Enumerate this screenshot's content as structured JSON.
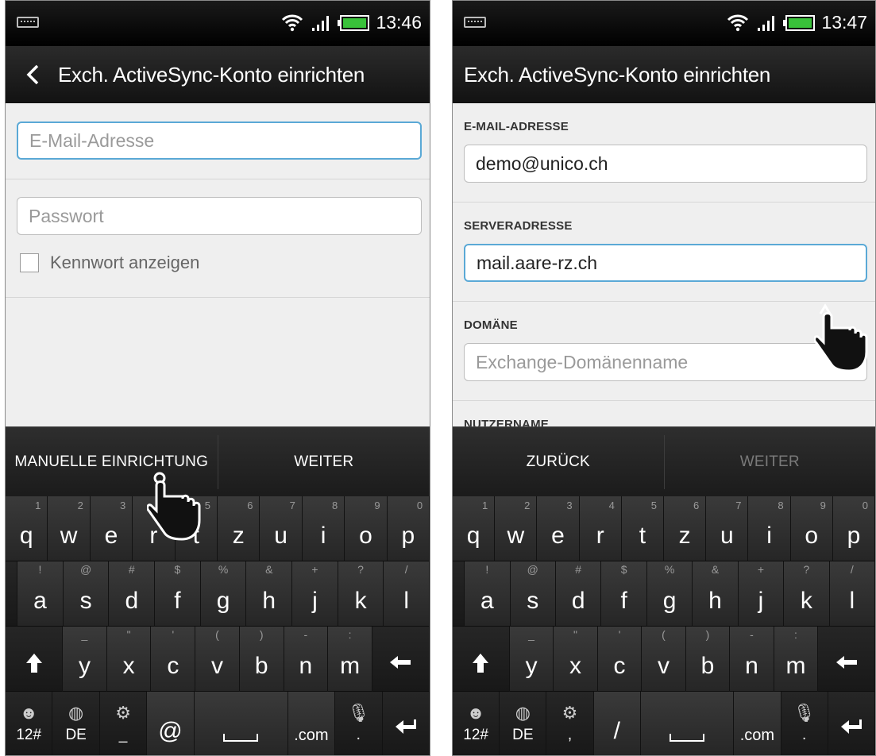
{
  "left": {
    "status": {
      "time": "13:46"
    },
    "title": "Exch. ActiveSync-Konto einrichten",
    "email": {
      "placeholder": "E-Mail-Adresse"
    },
    "password": {
      "placeholder": "Passwort"
    },
    "show_password": "Kennwort anzeigen",
    "actions": {
      "manual": "MANUELLE EINRICHTUNG",
      "next": "WEITER"
    },
    "keyboard": {
      "row1": [
        [
          "q",
          "1"
        ],
        [
          "w",
          "2"
        ],
        [
          "e",
          "3"
        ],
        [
          "r",
          "4"
        ],
        [
          "t",
          "5"
        ],
        [
          "z",
          "6"
        ],
        [
          "u",
          "7"
        ],
        [
          "i",
          "8"
        ],
        [
          "o",
          "9"
        ],
        [
          "p",
          "0"
        ]
      ],
      "row2": [
        [
          "a",
          "!"
        ],
        [
          "s",
          "@"
        ],
        [
          "d",
          "#"
        ],
        [
          "f",
          "$"
        ],
        [
          "g",
          "%"
        ],
        [
          "h",
          "&"
        ],
        [
          "j",
          "+"
        ],
        [
          "k",
          "?"
        ],
        [
          "l",
          "/"
        ]
      ],
      "row3": [
        [
          "y",
          "_"
        ],
        [
          "x",
          "\""
        ],
        [
          "c",
          "'"
        ],
        [
          "v",
          "("
        ],
        [
          "b",
          ")"
        ],
        [
          "n",
          "-"
        ],
        [
          "m",
          ":"
        ]
      ],
      "bottom": {
        "k1": "12#",
        "k2": "DE",
        "k3_sub": "_",
        "k4": "@",
        "k6": ".com",
        "k7_sub": "."
      }
    }
  },
  "right": {
    "status": {
      "time": "13:47"
    },
    "title": "Exch. ActiveSync-Konto einrichten",
    "email_label": "E-MAIL-ADRESSE",
    "email_value": "demo@unico.ch",
    "server_label": "SERVERADRESSE",
    "server_value": "mail.aare-rz.ch",
    "domain_label": "DOMÄNE",
    "domain_placeholder": "Exchange-Domänenname",
    "user_label": "NUTZERNAME",
    "actions": {
      "back": "ZURÜCK",
      "next": "WEITER"
    },
    "keyboard": {
      "bottom": {
        "k1": "12#",
        "k2": "DE",
        "k3_sub": ",",
        "k4": "/",
        "k6": ".com",
        "k7_sub": "."
      }
    }
  },
  "icons": [
    "keyboard-indicator-icon",
    "wifi-icon",
    "signal-icon",
    "battery-icon",
    "back-arrow-icon",
    "shift-icon",
    "backspace-icon",
    "enter-icon",
    "smiley-icon",
    "globe-icon",
    "settings-icon",
    "mic-icon",
    "hand-pointer-icon"
  ],
  "colors": {
    "focus": "#5aa9d6",
    "battery": "#39c23a",
    "titlebar": "#1b1b1b",
    "content": "#efefef"
  }
}
